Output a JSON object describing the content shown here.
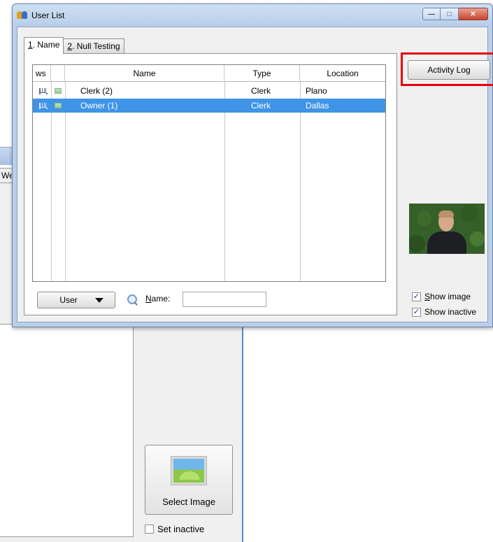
{
  "window": {
    "title": "User List",
    "controls": {
      "minimize": "—",
      "maximize": "□",
      "close": "✕"
    }
  },
  "tabs": [
    {
      "key": "1",
      "label": ". Name"
    },
    {
      "key": "2",
      "label": ". Null Testing"
    }
  ],
  "grid": {
    "columns": [
      "ws",
      "",
      "Name",
      "Type",
      "Location"
    ],
    "rows": [
      {
        "name": "Clerk (2)",
        "type": "Clerk",
        "location": "Plano",
        "selected": false
      },
      {
        "name": "Owner (1)",
        "type": "Clerk",
        "location": "Dallas",
        "selected": true
      }
    ]
  },
  "toolbar": {
    "user_button": "User",
    "name_label_key": "N",
    "name_label_rest": "ame:",
    "name_input_value": ""
  },
  "side": {
    "activity_log": "Activity Log",
    "show_image_key": "S",
    "show_image_rest": "how image",
    "show_image_checked": true,
    "show_inactive": "Show inactive",
    "show_inactive_checked": true
  },
  "background": {
    "tab_fragment": "We",
    "select_image": "Select Image",
    "set_inactive": "Set inactive",
    "set_inactive_checked": false
  },
  "colors": {
    "selection": "#3f94e8",
    "highlight": "#e60012"
  }
}
